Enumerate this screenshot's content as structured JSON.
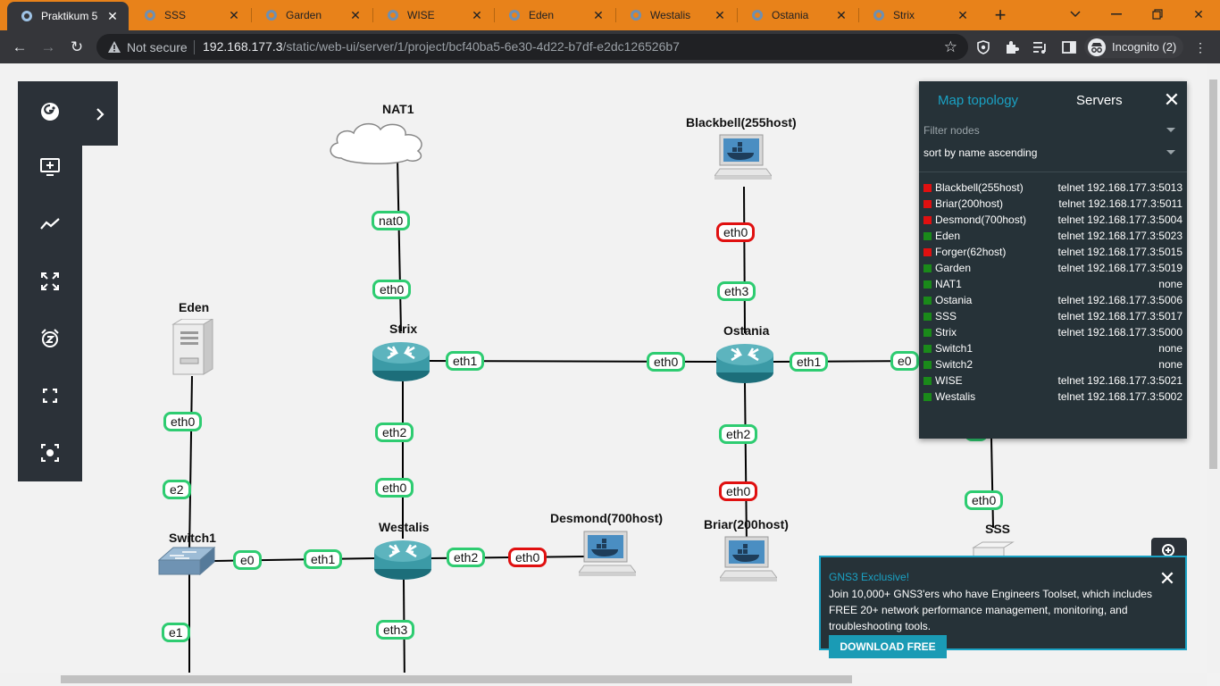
{
  "browser": {
    "tabs": [
      {
        "title": "Praktikum 5",
        "active": true
      },
      {
        "title": "SSS",
        "active": false
      },
      {
        "title": "Garden",
        "active": false
      },
      {
        "title": "WISE",
        "active": false
      },
      {
        "title": "Eden",
        "active": false
      },
      {
        "title": "Westalis",
        "active": false
      },
      {
        "title": "Ostania",
        "active": false
      },
      {
        "title": "Strix",
        "active": false
      }
    ],
    "security_label": "Not secure",
    "url_host": "192.168.177.3",
    "url_path": "/static/web-ui/server/1/project/bcf40ba5-6e30-4d22-b7df-e2dc126526b7",
    "incognito_label": "Incognito (2)"
  },
  "nodes": {
    "nat1": "NAT1",
    "blackbell": "Blackbell(255host)",
    "eden": "Eden",
    "strix": "Strix",
    "ostania": "Ostania",
    "switch1": "Switch1",
    "westalis": "Westalis",
    "desmond": "Desmond(700host)",
    "briar": "Briar(200host)",
    "sss": "SSS"
  },
  "links": {
    "nat0": "nat0",
    "strix_eth0": "eth0",
    "strix_eth1": "eth1",
    "ostania_eth0": "eth0",
    "ostania_eth1": "eth1",
    "wise_e0": "e0",
    "blackbell_eth0": "eth0",
    "ostania_eth3": "eth3",
    "ostania_eth2": "eth2",
    "briar_eth0": "eth0",
    "eden_eth0": "eth0",
    "switch1_e2": "e2",
    "strix_eth2": "eth2",
    "westalis_eth0": "eth0",
    "switch1_e0": "e0",
    "westalis_eth1": "eth1",
    "westalis_eth2": "eth2",
    "desmond_eth0": "eth0",
    "switch1_e1": "e1",
    "westalis_eth3": "eth3",
    "sss_eth0": "eth0"
  },
  "servers_panel": {
    "tab_map": "Map topology",
    "tab_servers": "Servers",
    "filter_placeholder": "Filter nodes",
    "sort_value": "sort by name ascending",
    "rows": [
      {
        "name": "Blackbell(255host)",
        "console": "telnet 192.168.177.3:5013",
        "status": "stopped"
      },
      {
        "name": "Briar(200host)",
        "console": "telnet 192.168.177.3:5011",
        "status": "stopped"
      },
      {
        "name": "Desmond(700host)",
        "console": "telnet 192.168.177.3:5004",
        "status": "stopped"
      },
      {
        "name": "Eden",
        "console": "telnet 192.168.177.3:5023",
        "status": "started"
      },
      {
        "name": "Forger(62host)",
        "console": "telnet 192.168.177.3:5015",
        "status": "stopped"
      },
      {
        "name": "Garden",
        "console": "telnet 192.168.177.3:5019",
        "status": "started"
      },
      {
        "name": "NAT1",
        "console": "none",
        "status": "started"
      },
      {
        "name": "Ostania",
        "console": "telnet 192.168.177.3:5006",
        "status": "started"
      },
      {
        "name": "SSS",
        "console": "telnet 192.168.177.3:5017",
        "status": "started"
      },
      {
        "name": "Strix",
        "console": "telnet 192.168.177.3:5000",
        "status": "started"
      },
      {
        "name": "Switch1",
        "console": "none",
        "status": "started"
      },
      {
        "name": "Switch2",
        "console": "none",
        "status": "started"
      },
      {
        "name": "WISE",
        "console": "telnet 192.168.177.3:5021",
        "status": "started"
      },
      {
        "name": "Westalis",
        "console": "telnet 192.168.177.3:5002",
        "status": "started"
      }
    ]
  },
  "promo": {
    "title": "GNS3 Exclusive!",
    "text": "Join 10,000+ GNS3'ers who have Engineers Toolset, which includes FREE 20+ network performance management, monitoring, and troubleshooting tools.",
    "button": "DOWNLOAD FREE"
  },
  "colors": {
    "link_ok": "#2ecc71",
    "link_down": "#e01010",
    "status_started": "#1a8a1a",
    "status_stopped": "#e01010",
    "accent": "#1aa2c4",
    "tabbar": "#e8821a"
  }
}
